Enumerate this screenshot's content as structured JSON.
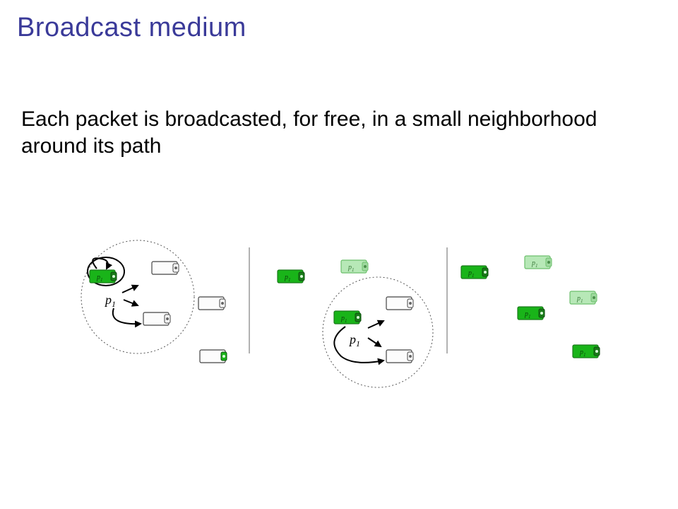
{
  "title": "Broadcast medium",
  "body": "Each packet is broadcasted, for free, in a small neighborhood around its path",
  "packet_label": "p",
  "packet_sub": "1",
  "node_label": "p",
  "node_sub": "1",
  "colors": {
    "title": "#3a3a99",
    "green_dark": "#19b419",
    "green_light": "#b7e8b7",
    "node_fill_empty": "#fcfcfc",
    "node_stroke": "#444",
    "circle_stroke": "#555"
  }
}
